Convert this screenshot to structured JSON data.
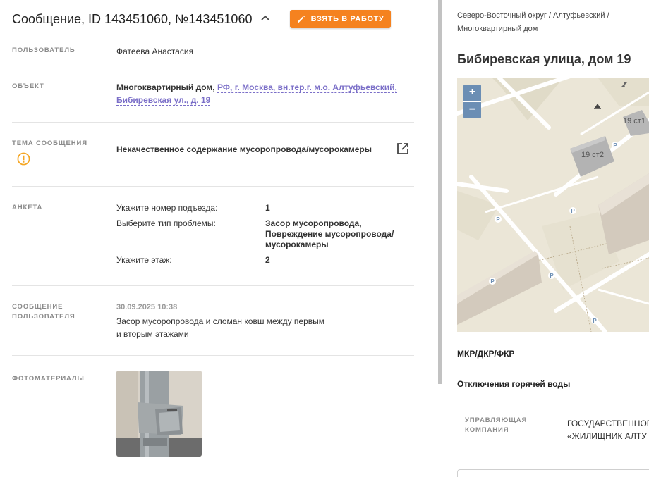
{
  "header": {
    "title": "Сообщение, ID 143451060, №143451060",
    "take_button_label": "ВЗЯТЬ В РАБОТУ"
  },
  "fields": {
    "user": {
      "label": "ПОЛЬЗОВАТЕЛЬ",
      "value": "Фатеева Анастасия"
    },
    "object": {
      "label": "ОБЪЕКТ",
      "type_prefix": "Многоквартирный дом,",
      "address_line1": "РФ, г. Москва, вн.тер.г. м.о. Алтуфьевский,",
      "address_line2": "Бибиревская ул., д. 19"
    },
    "topic": {
      "label": "ТЕМА СООБЩЕНИЯ",
      "value": "Некачественное содержание мусоропровода/мусорокамеры"
    },
    "survey": {
      "label": "АНКЕТА",
      "rows": [
        {
          "question": "Укажите номер подъезда:",
          "answer": "1"
        },
        {
          "question": "Выберите тип проблемы:",
          "answer_lines": [
            "Засор мусоропровода,",
            "Повреждение мусоропровода/",
            "мусорокамеры"
          ]
        },
        {
          "question": "Укажите этаж:",
          "answer": "2"
        }
      ]
    },
    "message": {
      "label_line1": "СООБЩЕНИЕ",
      "label_line2": "ПОЛЬЗОВАТЕЛЯ",
      "date": "30.09.2025 10:38",
      "text_line1": "Засор мусоропровода и сломан ковш между первым",
      "text_line2": "и вторым этажами"
    },
    "photos": {
      "label": "ФОТОМАТЕРИАЛЫ"
    }
  },
  "right": {
    "breadcrumb_line1": "Северо-Восточный округ / Алтуфьевский /",
    "breadcrumb_line2": "Многоквартирный дом",
    "title": "Бибиревская улица, дом 19",
    "map": {
      "zoom_in": "+",
      "zoom_out": "−",
      "building_labels": [
        "19 ст2",
        "19 ст1"
      ],
      "parking_marker": "P"
    },
    "section_mkr": "МКР/ДКР/ФКР",
    "section_hotwater": "Отключения горячей воды",
    "mgmt_label_line1": "УПРАВЛЯЮЩАЯ",
    "mgmt_label_line2": "КОМПАНИЯ",
    "mgmt_value_line1": "ГОСУДАРСТВЕННОЕ",
    "mgmt_value_line2": "«ЖИЛИЩНИК АЛТУ"
  },
  "colors": {
    "accent_orange": "#f5821f",
    "link_purple": "#7b6fc8",
    "warning_orange": "#f5a623",
    "map_zoom_blue": "#6b8eb4"
  }
}
